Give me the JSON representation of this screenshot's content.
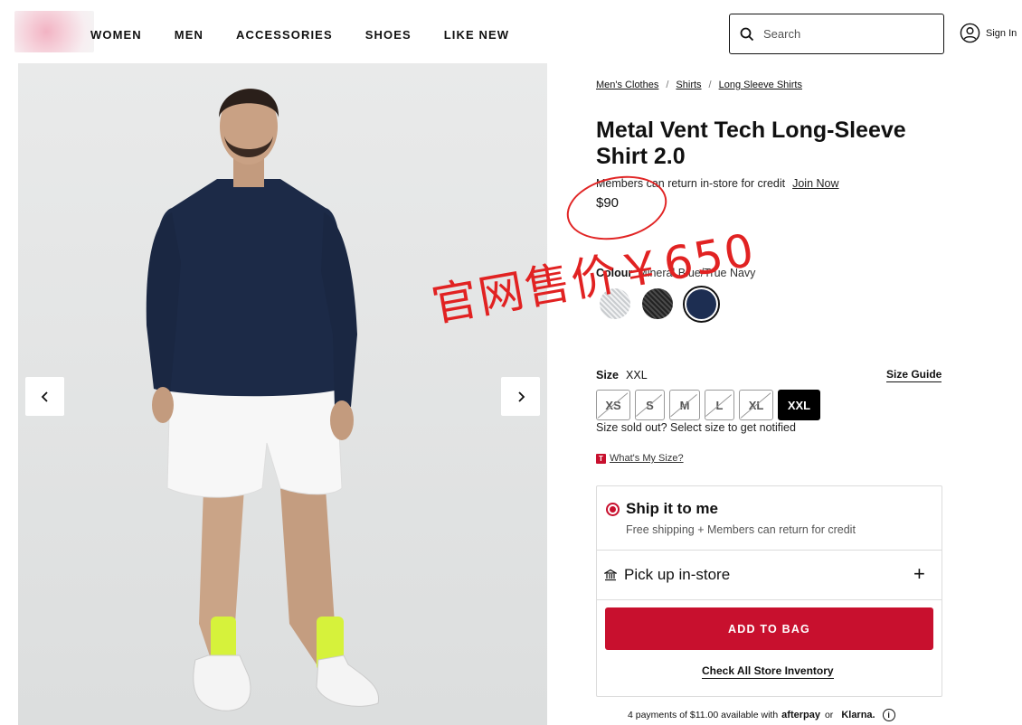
{
  "header": {
    "nav": [
      "WOMEN",
      "MEN",
      "ACCESSORIES",
      "SHOES",
      "LIKE NEW"
    ],
    "search_placeholder": "Search",
    "sign_in": "Sign In"
  },
  "breadcrumb": [
    "Men's Clothes",
    "Shirts",
    "Long Sleeve Shirts"
  ],
  "breadcrumb_separator": "/",
  "product": {
    "title": "Metal Vent Tech Long-Sleeve Shirt 2.0",
    "members_text": "Members can return in-store for credit",
    "join_now": "Join Now",
    "price": "$90"
  },
  "colour": {
    "label": "Colour",
    "selected_name": "Mineral Blue/True Navy",
    "swatch_colors": [
      "#d9dbdd",
      "#333333",
      "#1d2e52"
    ]
  },
  "overlay_annotation": "官网售价￥650",
  "size": {
    "label": "Size",
    "selected": "XXL",
    "guide": "Size Guide",
    "options": [
      "XS",
      "S",
      "M",
      "L",
      "XL",
      "XXL"
    ],
    "sold_out_note": "Size sold out? Select size to get notified",
    "whats_my_size": "What's My Size?",
    "badge": "T"
  },
  "delivery": {
    "ship_title": "Ship it to me",
    "ship_sub": "Free shipping + Members can return for credit",
    "pickup_title": "Pick up in-store",
    "plus": "+"
  },
  "cta": {
    "add_to_bag": "ADD TO BAG",
    "check_inventory": "Check All Store Inventory"
  },
  "payments": {
    "text": "4 payments of $11.00 available with",
    "afterpay": "afterpay",
    "or": "or",
    "klarna": "Klarna.",
    "info": "i"
  },
  "colors": {
    "accent_red": "#c8102e",
    "annotation_red": "#e12222"
  }
}
